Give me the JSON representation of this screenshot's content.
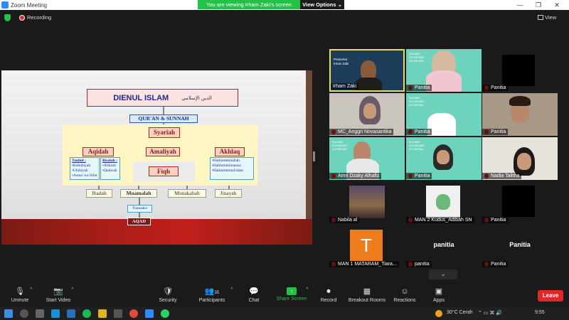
{
  "window": {
    "title": "Zoom Meeting",
    "minimize": "—",
    "maximize": "❐",
    "close": "✕"
  },
  "banner": {
    "message": "You are viewing Irham Zaki's screen",
    "options": "View Options ⌄"
  },
  "top": {
    "recording": "Recording",
    "view": "View"
  },
  "slide": {
    "title": "DIENUL ISLAM",
    "title_arabic": "الدين الإسلامي",
    "source": "QUR'AN & SUNNAH",
    "syariah": "Syariah",
    "aqidah": "Aqidah",
    "amaliyah": "Amaliyah",
    "akhlaq": "Akhlaq",
    "fiqh": "Fiqh",
    "tauhid_head": "Tauhid :",
    "tauhid_items": [
      "•Rububiyah",
      "•Uluhiyah",
      "•Asma' wa Sifat"
    ],
    "risalah_head": "Risalah :",
    "risalah_items": [
      "•Alikum",
      "•Qudwah"
    ],
    "akhlaq_items": [
      "•Hablumminallah",
      "•Hablumminannas",
      "•Hablumminal'alam"
    ],
    "branches": [
      "Ibadah",
      "Muamalah",
      "Munakahah",
      "Jinayah"
    ],
    "transaksi": "Transaksi",
    "aqad": "AQAD"
  },
  "participants": [
    {
      "name": "Irham Zaki",
      "muted": false
    },
    {
      "name": "Panitia",
      "muted": true
    },
    {
      "name": "Panitia",
      "muted": true
    },
    {
      "name": "MC_Anggri Novasantika",
      "muted": true
    },
    {
      "name": "Panitia",
      "muted": true
    },
    {
      "name": "Panitia",
      "muted": true
    },
    {
      "name": "Amri Dzaky Alhafiz",
      "muted": true
    },
    {
      "name": "Panitia",
      "muted": true
    },
    {
      "name": "Nadia Talitha",
      "muted": true
    },
    {
      "name": "Nabila al",
      "muted": true
    },
    {
      "name": "MAN 2 Kudus_Adibah SN",
      "muted": true
    },
    {
      "name": "Panitia",
      "muted": true
    },
    {
      "name": "MAN 1 MATARAM_Tiara...",
      "muted": true
    },
    {
      "name": "panitia",
      "muted": true
    },
    {
      "name": "Panitia",
      "muted": true
    }
  ],
  "tile_texts": {
    "irham_caption": "Presenter\nIrham Zaki",
    "panitia_big_1": "panitia",
    "panitia_big_2": "Panitia",
    "avatar_letter": "T",
    "slide_label": "ISLAMIC ECONOMIC OLYMPIAD"
  },
  "toolbar": {
    "unmute": "Unmute",
    "start_video": "Start Video",
    "security": "Security",
    "participants": "Participants",
    "participants_count": "35",
    "chat": "Chat",
    "share_screen": "Share Screen",
    "record": "Record",
    "breakout": "Breakout Rooms",
    "reactions": "Reactions",
    "apps": "Apps",
    "leave": "Leave"
  },
  "taskbar": {
    "weather": "30°C  Cerah",
    "time": "9:55"
  },
  "colors": {
    "zoom_green": "#23c246",
    "leave_red": "#e02828",
    "slide_red": "#b01e18",
    "active_speaker": "#e8e04a"
  }
}
